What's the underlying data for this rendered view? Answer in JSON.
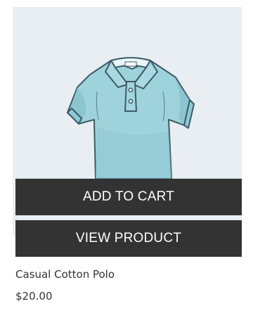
{
  "product": {
    "name": "Casual Cotton Polo",
    "price": "$20.00",
    "image_icon": "polo-shirt-illustration",
    "image_colors": {
      "background": "#e8eef2",
      "shirt": "#9fd3dc",
      "shirt_shadow": "#79b9c6",
      "outline": "#3c5a66"
    }
  },
  "actions": {
    "add_to_cart_label": "ADD TO CART",
    "view_product_label": "VIEW PRODUCT",
    "button_color": "#333333",
    "button_text_color": "#ffffff"
  }
}
